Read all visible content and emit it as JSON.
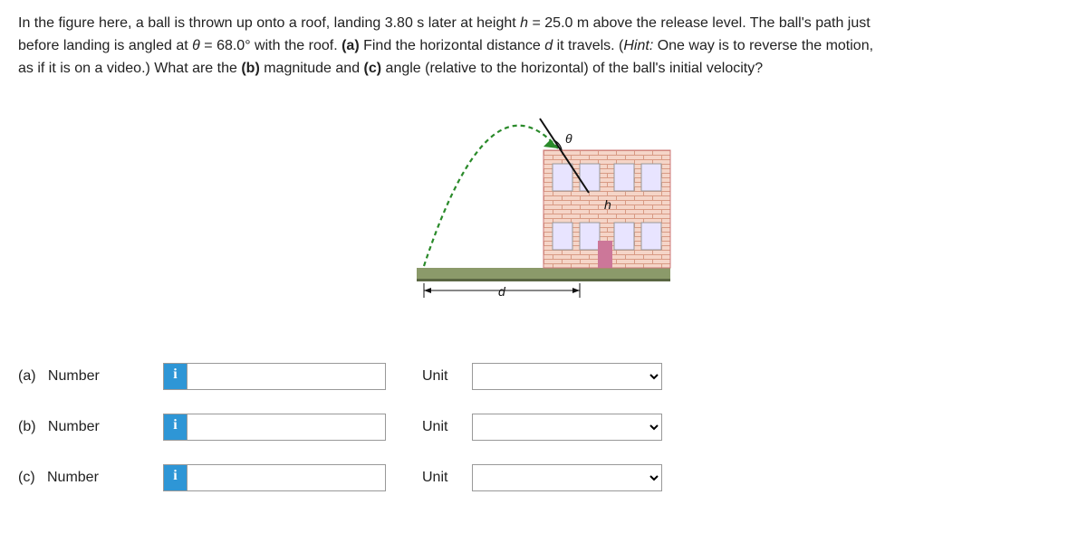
{
  "problem": {
    "line1_a": "In the figure here, a ball is thrown up onto a roof, landing 3.80 s later at height ",
    "h_var": "h",
    "line1_b": " = 25.0 m above the release level. The ball's path just",
    "line2_a": "before landing is angled at ",
    "theta_var": "θ",
    "line2_b": " = 68.0° with the roof. ",
    "part_a_bold": "(a)",
    "line2_c": " Find the horizontal distance ",
    "d_var": "d",
    "line2_d": " it travels. (",
    "hint_label": "Hint:",
    "line2_e": " One way is to reverse the motion,",
    "line3_a": "as if it is on a video.) What are the ",
    "part_b_bold": "(b)",
    "line3_b": " magnitude and ",
    "part_c_bold": "(c)",
    "line3_c": " angle (relative to the horizontal) of the ball's initial velocity?"
  },
  "figure": {
    "theta_label": "θ",
    "h_label": "h",
    "d_label": "d"
  },
  "answers": {
    "a": {
      "part": "(a)",
      "label": "Number",
      "icon": "i",
      "unit_label": "Unit"
    },
    "b": {
      "part": "(b)",
      "label": "Number",
      "icon": "i",
      "unit_label": "Unit"
    },
    "c": {
      "part": "(c)",
      "label": "Number",
      "icon": "i",
      "unit_label": "Unit"
    }
  }
}
